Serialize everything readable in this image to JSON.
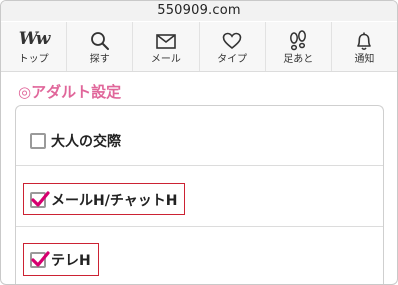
{
  "browser": {
    "url": "550909.com"
  },
  "nav": {
    "items": [
      {
        "label": "トップ",
        "icon": "ww-logo",
        "logo_text": "Ww"
      },
      {
        "label": "探す",
        "icon": "search-icon"
      },
      {
        "label": "メール",
        "icon": "mail-icon"
      },
      {
        "label": "タイプ",
        "icon": "heart-icon"
      },
      {
        "label": "足あと",
        "icon": "footprints-icon"
      },
      {
        "label": "通知",
        "icon": "bell-icon"
      }
    ]
  },
  "section": {
    "title": "◎アダルト設定",
    "accent_color": "#e0669a"
  },
  "options": [
    {
      "label": "大人の交際",
      "checked": false
    },
    {
      "label": "メールH/チャットH",
      "checked": true
    },
    {
      "label": "テレH",
      "checked": true
    }
  ],
  "colors": {
    "check": "#d6006f",
    "highlight": "#cc2233"
  }
}
